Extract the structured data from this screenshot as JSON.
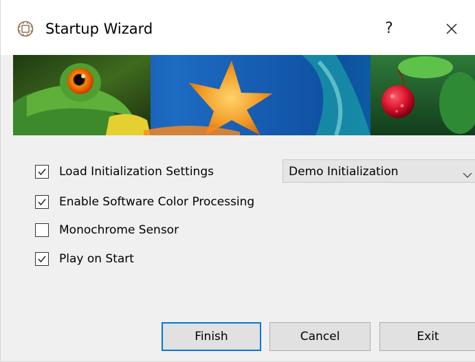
{
  "window": {
    "title": "Startup Wizard",
    "help_label": "?"
  },
  "options": [
    {
      "label": "Load Initialization Settings",
      "checked": true
    },
    {
      "label": "Enable Software Color Processing",
      "checked": true
    },
    {
      "label": "Monochrome Sensor",
      "checked": false
    },
    {
      "label": "Play on Start",
      "checked": true
    }
  ],
  "init_select": {
    "selected": "Demo Initialization"
  },
  "buttons": {
    "finish": "Finish",
    "cancel": "Cancel",
    "exit": "Exit"
  },
  "colors": {
    "default_button_border": "#0078d7",
    "window_background": "#f0f0f0",
    "button_background": "#e1e1e1"
  }
}
